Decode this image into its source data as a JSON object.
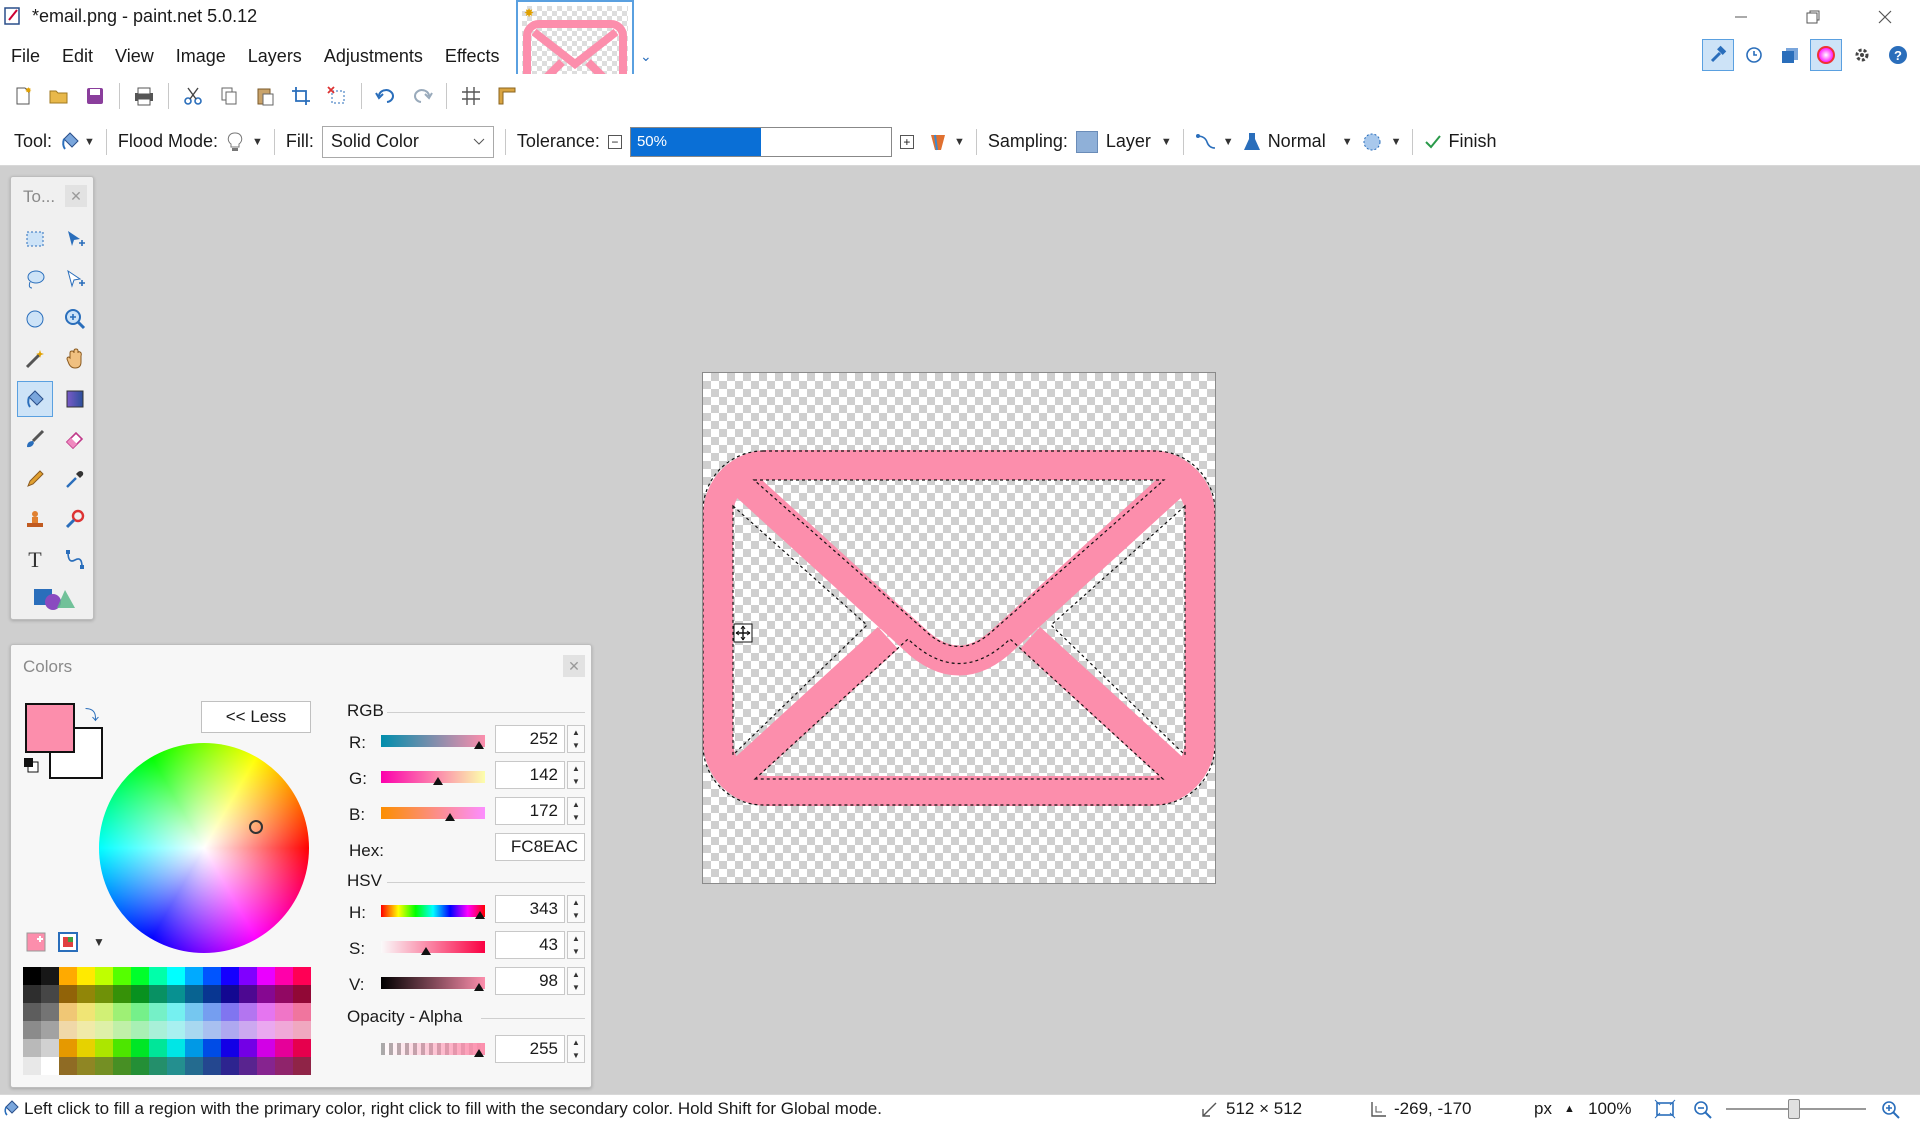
{
  "window": {
    "title": "*email.png - paint.net 5.0.12",
    "controls": [
      "minimize-icon",
      "restore-icon",
      "close-icon"
    ]
  },
  "menu": [
    "File",
    "Edit",
    "View",
    "Image",
    "Layers",
    "Adjustments",
    "Effects"
  ],
  "toolbar": {
    "tool_label": "Tool:",
    "flood_mode_label": "Flood Mode:",
    "fill_label": "Fill:",
    "fill_value": "Solid Color",
    "tolerance_label": "Tolerance:",
    "tolerance_value": "50%",
    "tolerance_percent": 50,
    "sampling_label": "Sampling:",
    "sampling_value": "Layer",
    "blend_mode": "Normal",
    "finish_label": "Finish"
  },
  "tools_panel": {
    "title": "To...",
    "tools": [
      "rectangle-select-icon",
      "move-selection-icon",
      "lasso-select-icon",
      "move-selected-icon",
      "ellipse-select-icon",
      "zoom-icon",
      "magic-wand-icon",
      "pan-icon",
      "paint-bucket-icon",
      "gradient-icon",
      "paintbrush-icon",
      "eraser-icon",
      "pencil-icon",
      "color-picker-icon",
      "clone-stamp-icon",
      "recolor-icon",
      "text-icon",
      "line-curve-icon",
      "shapes-icon"
    ],
    "active_tool": "paint-bucket-icon"
  },
  "colors_panel": {
    "title": "Colors",
    "less_button": "<< Less",
    "primary_color": "#FC8EAC",
    "secondary_color": "#FFFFFF",
    "rgb_label": "RGB",
    "r_label": "R:",
    "r_value": "252",
    "g_label": "G:",
    "g_value": "142",
    "b_label": "B:",
    "b_value": "172",
    "hex_label": "Hex:",
    "hex_value": "FC8EAC",
    "hsv_label": "HSV",
    "h_label": "H:",
    "h_value": "343",
    "s_label": "S:",
    "s_value": "43",
    "v_label": "V:",
    "v_value": "98",
    "opacity_label": "Opacity - Alpha",
    "alpha_value": "255"
  },
  "status": {
    "hint": "Left click to fill a region with the primary color, right click to fill with the secondary color. Hold Shift for Global mode.",
    "image_size": "512 × 512",
    "cursor_pos": "-269, -170",
    "unit": "px",
    "zoom": "100%"
  },
  "colors": {
    "accent": "#0a6fd6",
    "envelope": "#FC8EAC"
  }
}
